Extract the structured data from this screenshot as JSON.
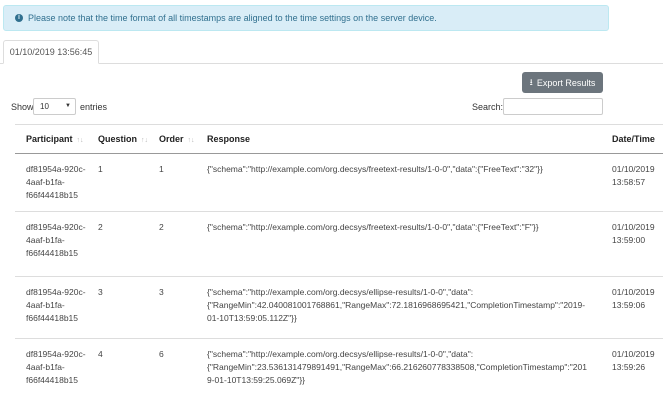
{
  "notice": {
    "icon": "info-icon",
    "text": "Please note that the time format of all timestamps are aligned to the time settings on the server device."
  },
  "tab": {
    "label": "01/10/2019 13:56:45"
  },
  "toolbar": {
    "export_icon": "download-icon",
    "export_label": "Export Results"
  },
  "controls": {
    "show_label": "Show",
    "entries_value": "10",
    "entries_label": "entries",
    "search_label": "Search:",
    "search_value": ""
  },
  "table": {
    "headers": [
      "Participant",
      "Question",
      "Order",
      "Response",
      "Date/Time"
    ],
    "rows": [
      {
        "participant": "df81954a-920c-4aaf-b1fa-f66f44418b15",
        "question": "1",
        "order": "1",
        "response": "{\"schema\":\"http://example.com/org.decsys/freetext-results/1-0-0\",\"data\":{\"FreeText\":\"32\"}}",
        "datetime": "01/10/2019 13:58:57"
      },
      {
        "participant": "df81954a-920c-4aaf-b1fa-f66f44418b15",
        "question": "2",
        "order": "2",
        "response": "{\"schema\":\"http://example.com/org.decsys/freetext-results/1-0-0\",\"data\":{\"FreeText\":\"F\"}}",
        "datetime": "01/10/2019 13:59:00"
      },
      {
        "participant": "df81954a-920c-4aaf-b1fa-f66f44418b15",
        "question": "3",
        "order": "3",
        "response": "{\"schema\":\"http://example.com/org.decsys/ellipse-results/1-0-0\",\"data\":{\"RangeMin\":42.040081001768861,\"RangeMax\":72.1816968695421,\"CompletionTimestamp\":\"2019-01-10T13:59:05.112Z\"}}",
        "datetime": "01/10/2019 13:59:06"
      },
      {
        "participant": "df81954a-920c-4aaf-b1fa-f66f44418b15",
        "question": "4",
        "order": "6",
        "response": "{\"schema\":\"http://example.com/org.decsys/ellipse-results/1-0-0\",\"data\":{\"RangeMin\":23.536131479891491,\"RangeMax\":66.216260778338508,\"CompletionTimestamp\":\"2019-01-10T13:59:25.069Z\"}}",
        "datetime": "01/10/2019 13:59:26"
      }
    ]
  }
}
